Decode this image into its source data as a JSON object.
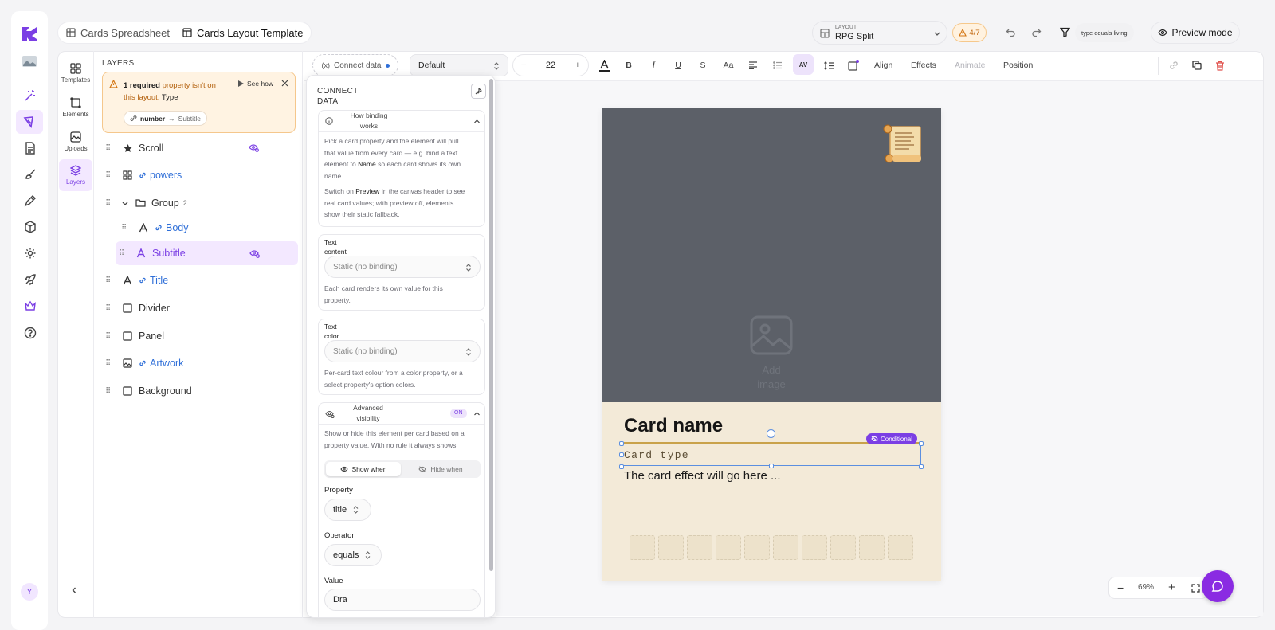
{
  "tabs": {
    "spreadsheet": "Cards Spreadsheet",
    "layout": "Cards Layout Template"
  },
  "layout_select": {
    "caption": "LAYOUT",
    "value": "RPG Split"
  },
  "warning_badge": "4/7",
  "filter_chip": "type equals living",
  "preview_mode": "Preview mode",
  "user_initial": "Y",
  "sidebar": {
    "templates": "Templates",
    "elements": "Elements",
    "uploads": "Uploads",
    "layers": "Layers"
  },
  "layers": {
    "header": "LAYERS",
    "alert": {
      "count": "1 required",
      "text1": " property isn't on",
      "text2": "this layout: ",
      "property": "Type",
      "see_how": "See how",
      "chip_from": "number",
      "chip_to": "Subtitle"
    },
    "items": [
      {
        "label": "Scroll"
      },
      {
        "label": "powers"
      },
      {
        "label": "Group",
        "count": "2"
      },
      {
        "label": "Body"
      },
      {
        "label": "Subtitle"
      },
      {
        "label": "Title"
      },
      {
        "label": "Divider"
      },
      {
        "label": "Panel"
      },
      {
        "label": "Artwork"
      },
      {
        "label": "Background"
      }
    ]
  },
  "toolbar": {
    "connect_data": "Connect data",
    "font": "Default",
    "font_size": "22",
    "align": "Align",
    "effects": "Effects",
    "animate": "Animate",
    "position": "Position"
  },
  "connect_panel": {
    "title_line1": "CONNECT",
    "title_line2": "DATA",
    "binding": {
      "header_line1": "How binding",
      "header_line2": "works",
      "p1a": "Pick a card property and the element will pull",
      "p1b": "that value from every card — e.g. bind a text",
      "p1c": "element to ",
      "p1c_bold": "Name",
      "p1c_end": " so each card shows its own",
      "p1d": "name.",
      "p2a": "Switch on ",
      "p2a_bold": "Preview",
      "p2a_end": " in the canvas header to see",
      "p2b": "real card values; with preview off, elements",
      "p2c": "show their static fallback."
    },
    "text_content": {
      "label1": "Text",
      "label2": "content",
      "select": "Static (no binding)",
      "help1": "Each card renders its own value for this",
      "help2": "property."
    },
    "text_color": {
      "label1": "Text",
      "label2": "color",
      "select": "Static (no binding)",
      "help1": "Per-card text colour from a color property, or a",
      "help2": "select property's option colors."
    },
    "visibility": {
      "header1": "Advanced",
      "header2": "visibility",
      "toggle": "ON",
      "help1": "Show or hide this element per card based on a",
      "help2": "property value. With no rule it always shows.",
      "show_when": "Show when",
      "hide_when": "Hide when",
      "property_label": "Property",
      "property_value": "title",
      "operator_label": "Operator",
      "operator_value": "equals",
      "value_label": "Value",
      "value_value": "Dra"
    }
  },
  "canvas": {
    "add_image_line1": "Add",
    "add_image_line2": "image",
    "card_name": "Card name",
    "card_type": "Card type",
    "conditional_badge": "Conditional",
    "card_effect": "The card effect will go here ..."
  },
  "zoom": {
    "value": "69%"
  },
  "colors": {
    "accent": "#7b3fe4",
    "link": "#2f6fd8",
    "warning": "#f6a14a",
    "delete": "#e0524d",
    "card_bg": "#f3ead8",
    "art_bg": "#5c6068"
  }
}
